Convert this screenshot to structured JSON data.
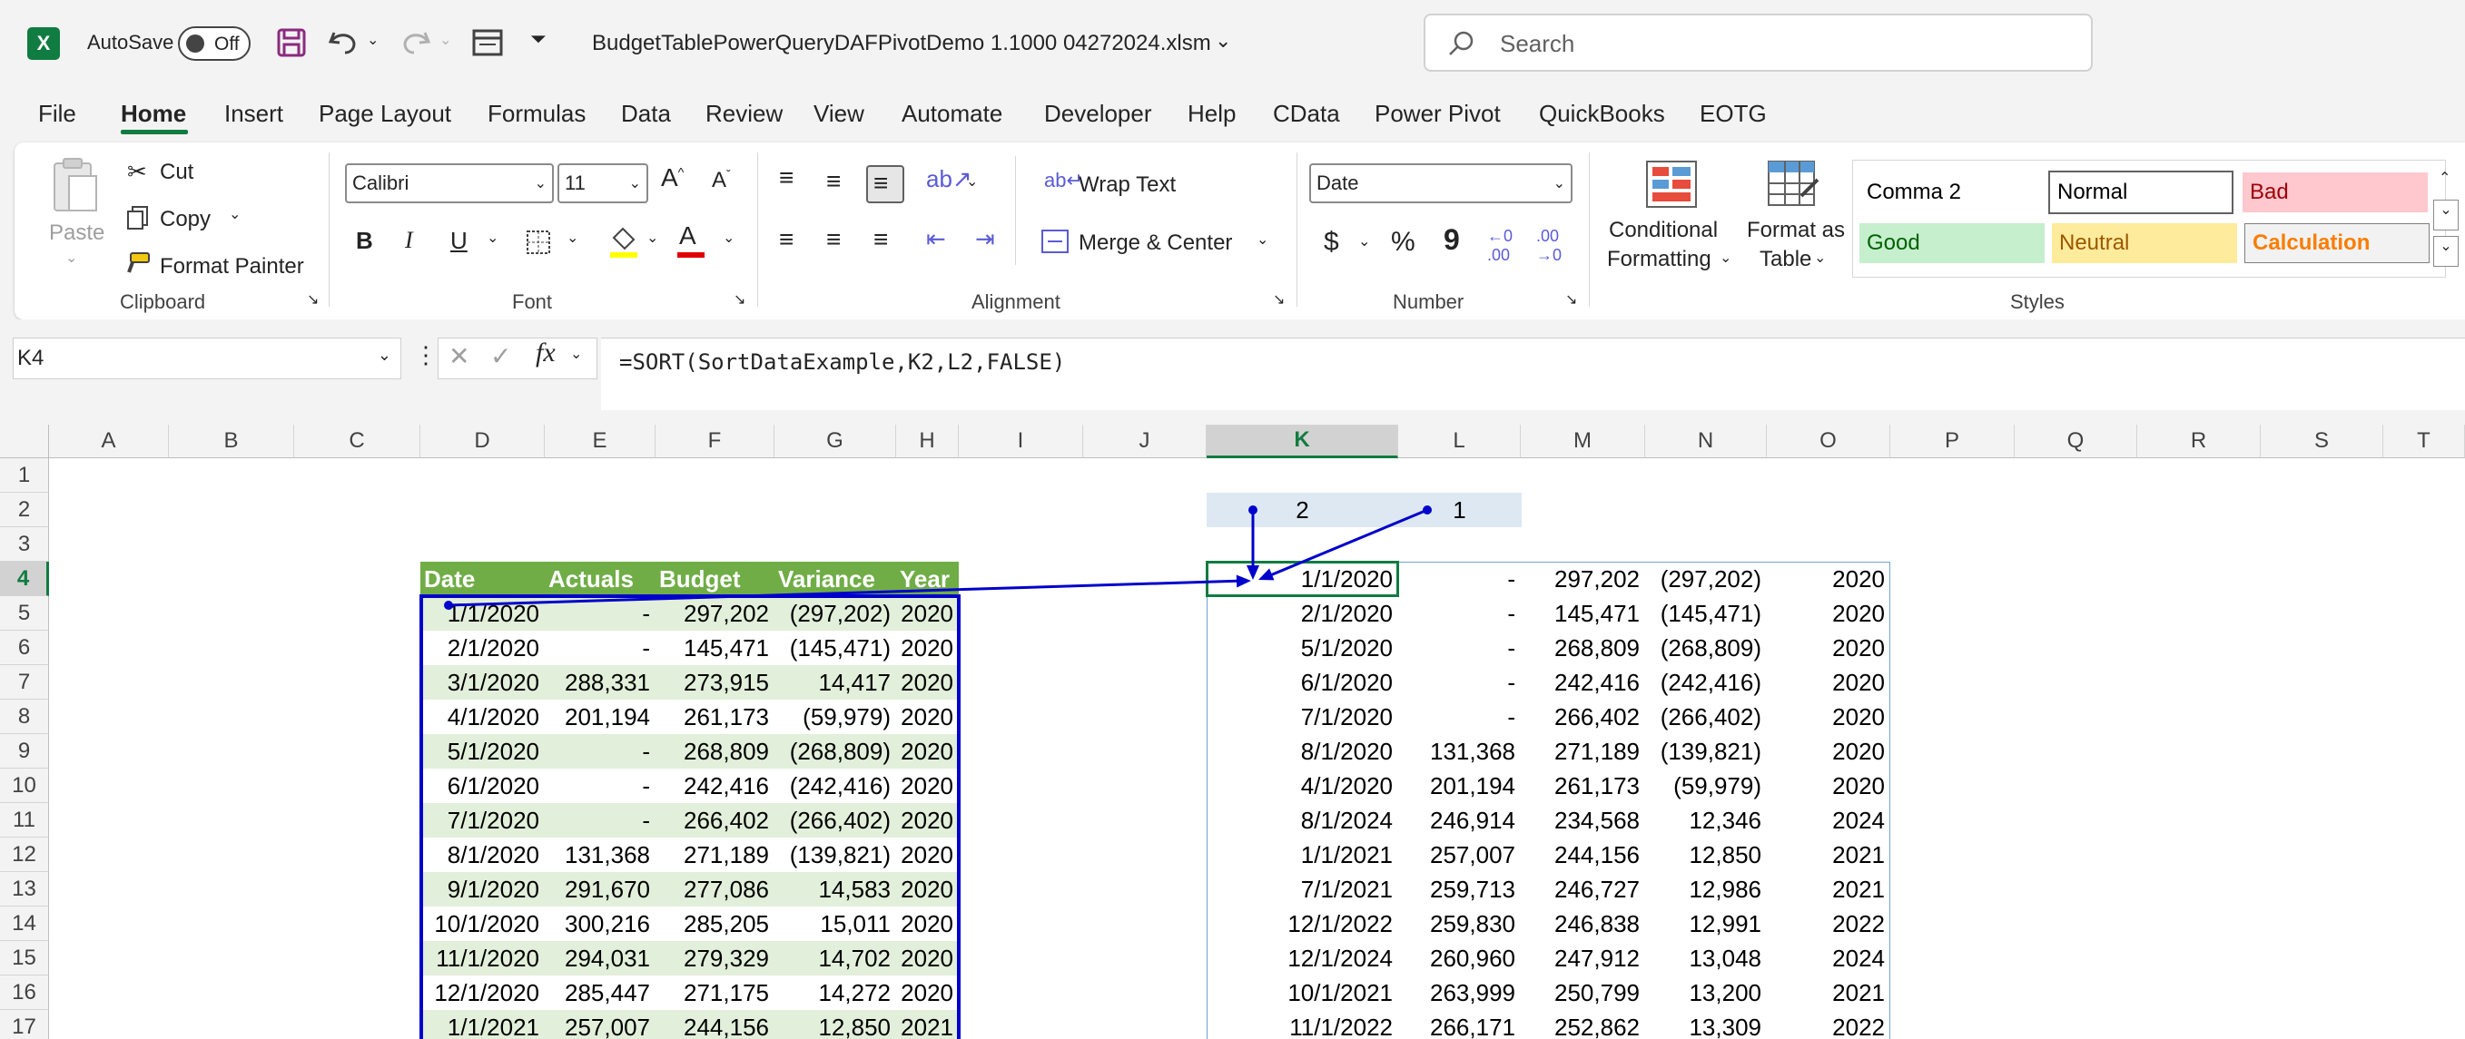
{
  "titlebar": {
    "autosave_label": "AutoSave",
    "autosave_state": "Off",
    "filename": "BudgetTablePowerQueryDAFPivotDemo 1.1000   04272024.xlsm",
    "search_placeholder": "Search",
    "app_icon_letter": "X",
    "accent_color": "#107c41"
  },
  "menu": [
    "File",
    "Home",
    "Insert",
    "Page Layout",
    "Formulas",
    "Data",
    "Review",
    "View",
    "Automate",
    "Developer",
    "Help",
    "CData",
    "Power Pivot",
    "QuickBooks",
    "EOTG"
  ],
  "ribbon": {
    "clipboard": {
      "paste": "Paste",
      "cut": "Cut",
      "copy": "Copy",
      "format_painter": "Format Painter",
      "label": "Clipboard"
    },
    "font": {
      "name": "Calibri",
      "size": "11",
      "label": "Font",
      "bold": "B",
      "italic": "I",
      "underline": "U"
    },
    "alignment": {
      "wrap_text": "Wrap Text",
      "merge_center": "Merge & Center",
      "label": "Alignment"
    },
    "number": {
      "format": "Date",
      "currency": "$",
      "percent": "%",
      "comma": "9",
      "label": "Number"
    },
    "conditional": {
      "line1": "Conditional",
      "line2": "Formatting"
    },
    "format_table": {
      "line1": "Format as",
      "line2": "Table"
    },
    "styles": {
      "items": [
        {
          "name": "Comma 2",
          "bg": "#ffffff",
          "fg": "#000000"
        },
        {
          "name": "Normal",
          "bg": "#ffffff",
          "fg": "#000000"
        },
        {
          "name": "Bad",
          "bg": "#ffc7ce",
          "fg": "#9c0006"
        },
        {
          "name": "Good",
          "bg": "#c6efce",
          "fg": "#006100"
        },
        {
          "name": "Neutral",
          "bg": "#ffeb9c",
          "fg": "#9c5700"
        },
        {
          "name": "Calculation",
          "bg": "#f2f2f2",
          "fg": "#fa7d00"
        }
      ],
      "label": "Styles"
    }
  },
  "formula_bar": {
    "name_box": "K4",
    "formula": "=SORT(SortDataExample,K2,L2,FALSE)",
    "fx": "fx"
  },
  "sheet": {
    "columns": [
      "A",
      "B",
      "C",
      "D",
      "E",
      "F",
      "G",
      "H",
      "I",
      "J",
      "K",
      "L",
      "M",
      "N",
      "O",
      "P",
      "Q",
      "R",
      "S",
      "T"
    ],
    "rows": [
      "1",
      "2",
      "3",
      "4",
      "5",
      "6",
      "7",
      "8",
      "9",
      "10",
      "11",
      "12",
      "13",
      "14",
      "15",
      "16",
      "17"
    ],
    "k2": "2",
    "l2": "1",
    "table_headers": [
      "Date",
      "Actuals",
      "Budget",
      "Variance",
      "Year"
    ],
    "table_rows": [
      [
        "1/1/2020",
        "-",
        "297,202",
        "(297,202)",
        "2020"
      ],
      [
        "2/1/2020",
        "-",
        "145,471",
        "(145,471)",
        "2020"
      ],
      [
        "3/1/2020",
        "288,331",
        "273,915",
        "14,417",
        "2020"
      ],
      [
        "4/1/2020",
        "201,194",
        "261,173",
        "(59,979)",
        "2020"
      ],
      [
        "5/1/2020",
        "-",
        "268,809",
        "(268,809)",
        "2020"
      ],
      [
        "6/1/2020",
        "-",
        "242,416",
        "(242,416)",
        "2020"
      ],
      [
        "7/1/2020",
        "-",
        "266,402",
        "(266,402)",
        "2020"
      ],
      [
        "8/1/2020",
        "131,368",
        "271,189",
        "(139,821)",
        "2020"
      ],
      [
        "9/1/2020",
        "291,670",
        "277,086",
        "14,583",
        "2020"
      ],
      [
        "10/1/2020",
        "300,216",
        "285,205",
        "15,011",
        "2020"
      ],
      [
        "11/1/2020",
        "294,031",
        "279,329",
        "14,702",
        "2020"
      ],
      [
        "12/1/2020",
        "285,447",
        "271,175",
        "14,272",
        "2020"
      ],
      [
        "1/1/2021",
        "257,007",
        "244,156",
        "12,850",
        "2021"
      ]
    ],
    "sorted_rows": [
      [
        "1/1/2020",
        "-",
        "297,202",
        "(297,202)",
        "2020"
      ],
      [
        "2/1/2020",
        "-",
        "145,471",
        "(145,471)",
        "2020"
      ],
      [
        "5/1/2020",
        "-",
        "268,809",
        "(268,809)",
        "2020"
      ],
      [
        "6/1/2020",
        "-",
        "242,416",
        "(242,416)",
        "2020"
      ],
      [
        "7/1/2020",
        "-",
        "266,402",
        "(266,402)",
        "2020"
      ],
      [
        "8/1/2020",
        "131,368",
        "271,189",
        "(139,821)",
        "2020"
      ],
      [
        "4/1/2020",
        "201,194",
        "261,173",
        "(59,979)",
        "2020"
      ],
      [
        "8/1/2024",
        "246,914",
        "234,568",
        "12,346",
        "2024"
      ],
      [
        "1/1/2021",
        "257,007",
        "244,156",
        "12,850",
        "2021"
      ],
      [
        "7/1/2021",
        "259,713",
        "246,727",
        "12,986",
        "2021"
      ],
      [
        "12/1/2022",
        "259,830",
        "246,838",
        "12,991",
        "2022"
      ],
      [
        "12/1/2024",
        "260,960",
        "247,912",
        "13,048",
        "2024"
      ],
      [
        "10/1/2021",
        "263,999",
        "250,799",
        "13,200",
        "2021"
      ],
      [
        "11/1/2022",
        "266,171",
        "252,862",
        "13,309",
        "2022"
      ]
    ]
  }
}
